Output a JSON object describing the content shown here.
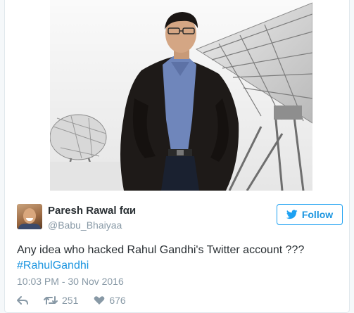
{
  "tweet": {
    "author_name": "Paresh Rawal fαи",
    "author_handle": "@Babu_Bhaiyaa",
    "follow_label": "Follow",
    "text_main": "Any idea who hacked Rahul Gandhi's Twitter account ???",
    "hashtag": "#RahulGandhi",
    "timestamp": "10:03 PM - 30 Nov 2016",
    "retweet_count": "251",
    "like_count": "676"
  },
  "colors": {
    "accent": "#1da1f2",
    "link": "#1b95e0",
    "text": "#292f33",
    "muted": "#8899a6",
    "border": "#e1e8ed"
  },
  "icons": {
    "follow": "bird-icon",
    "reply": "reply-icon",
    "retweet": "retweet-icon",
    "like": "heart-icon"
  }
}
